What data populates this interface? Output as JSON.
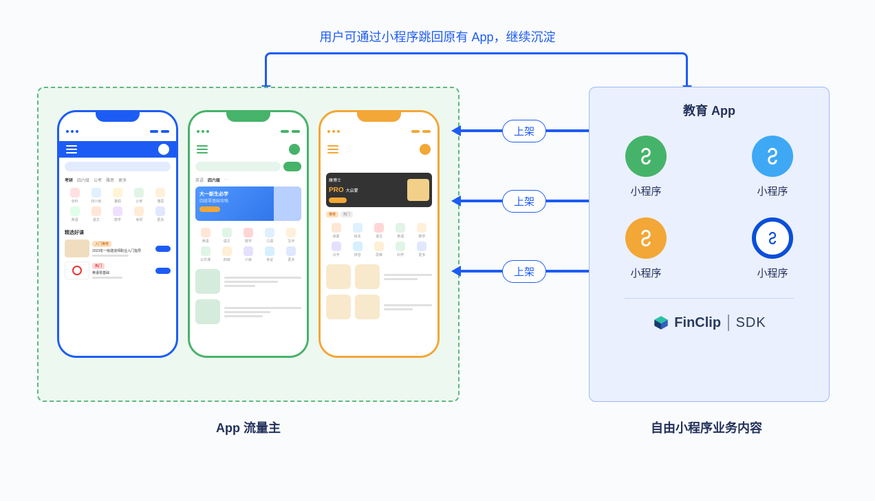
{
  "top_label": "用户可通过小程序跳回原有 App，继续沉淀",
  "arrows": [
    {
      "label": "上架"
    },
    {
      "label": "上架"
    },
    {
      "label": "上架"
    }
  ],
  "left": {
    "label": "App 流量主"
  },
  "right": {
    "title": "教育 App",
    "label": "自由小程序业务内容",
    "miniprograms": [
      {
        "label": "小程序",
        "color": "#46b36a"
      },
      {
        "label": "小程序",
        "color": "#3ea8f4"
      },
      {
        "label": "小程序",
        "color": "#f2a737"
      },
      {
        "label": "小程序",
        "color": "#0a4fd8",
        "ring": true
      }
    ],
    "sdk": {
      "brand": "FinClip",
      "suffix": "SDK"
    }
  },
  "phones": {
    "blue": {
      "tabs": [
        "考研",
        "四六级",
        "公考",
        "雅思",
        "更多"
      ],
      "icon_labels": [
        "全科",
        "四六级",
        "暑假",
        "公考",
        "雅思",
        "英语",
        "语文",
        "数学",
        "考研",
        "更多"
      ],
      "section": "精选好课",
      "card1_tag": "入门推荐",
      "card1_title": "2023年一级建造师职业入门指导",
      "card2_title": "英语零基础"
    },
    "green": {
      "tab_active": "四六级",
      "banner_l1": "大一新生必学",
      "banner_l2": "四级零基础攻略",
      "icon_labels": [
        "英语",
        "语文",
        "数学",
        "口语",
        "写作",
        "公共课",
        "四级",
        "六级",
        "考证",
        "更多"
      ]
    },
    "orange": {
      "banner_brand": "雁博士",
      "banner_pro": "PRO",
      "banner_sub": "大启蒙",
      "icon_labels": [
        "启蒙",
        "绘本",
        "语文",
        "英语",
        "数学",
        "识字",
        "拼音",
        "思维",
        "科学",
        "更多"
      ]
    }
  },
  "colors": {
    "primary": "#1d5cf4",
    "green": "#46b36a",
    "orange": "#f2a737"
  }
}
